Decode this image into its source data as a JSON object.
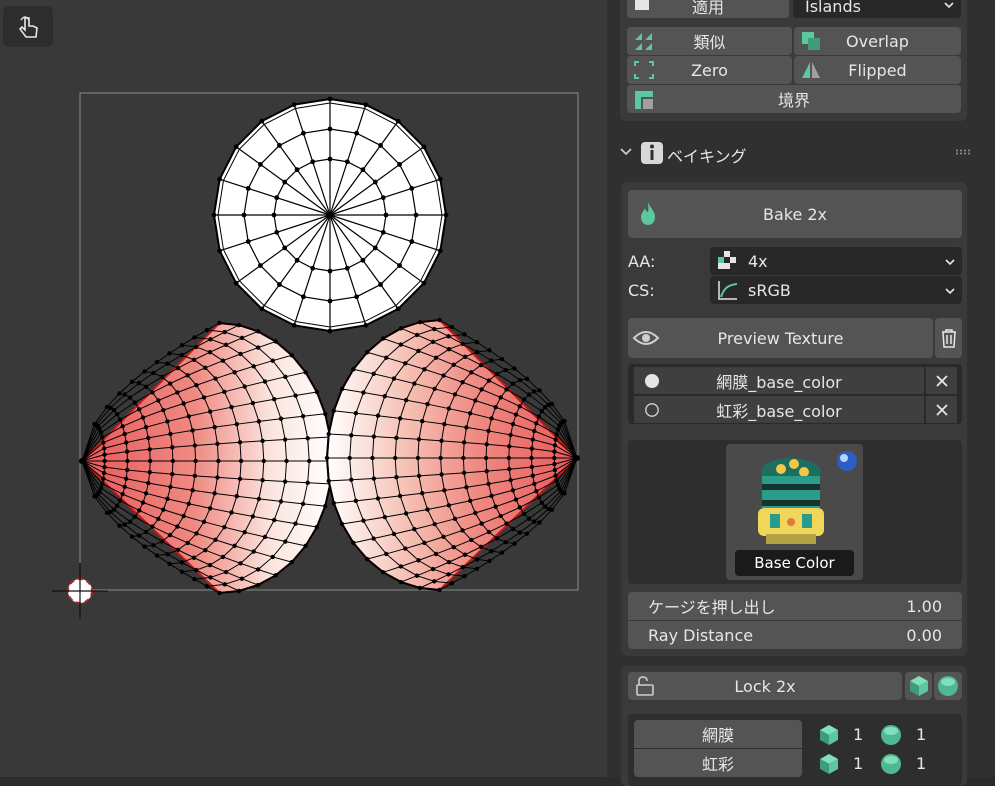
{
  "top_row": {
    "apply_label": "適用",
    "islands_value": "Islands"
  },
  "select_buttons": {
    "similar": "類似",
    "overlap": "Overlap",
    "zero": "Zero",
    "flipped": "Flipped",
    "boundary": "境界"
  },
  "baking": {
    "title": "ベイキング",
    "bake_label": "Bake 2x",
    "aa_label": "AA:",
    "aa_value": "4x",
    "cs_label": "CS:",
    "cs_value": "sRGB",
    "preview_label": "Preview Texture",
    "textures": [
      {
        "name": "網膜_base_color",
        "selected": true
      },
      {
        "name": "虹彩_base_color",
        "selected": false
      }
    ],
    "thumbnail_caption": "Base Color",
    "extrusion_label": "ケージを押し出し",
    "extrusion_value": "1.00",
    "ray_label": "Ray Distance",
    "ray_value": "0.00"
  },
  "lock": {
    "label": "Lock 2x",
    "rows": [
      {
        "name": "網膜",
        "count1": "1",
        "count2": "1"
      },
      {
        "name": "虹彩",
        "count1": "1",
        "count2": "1"
      }
    ]
  },
  "colors": {
    "accent": "#5bc8a0",
    "uv_red": "#e8595a",
    "panel": "#3a3a3a",
    "button": "#545454"
  },
  "icons": [
    "touch-tool-icon",
    "flame-icon",
    "checker-icon",
    "curve-icon",
    "eye-icon",
    "trash-icon",
    "remove-icon",
    "cube-icon",
    "sphere-icon",
    "lock-icon",
    "info-icon",
    "chevron-down-icon",
    "cursor-icon"
  ]
}
